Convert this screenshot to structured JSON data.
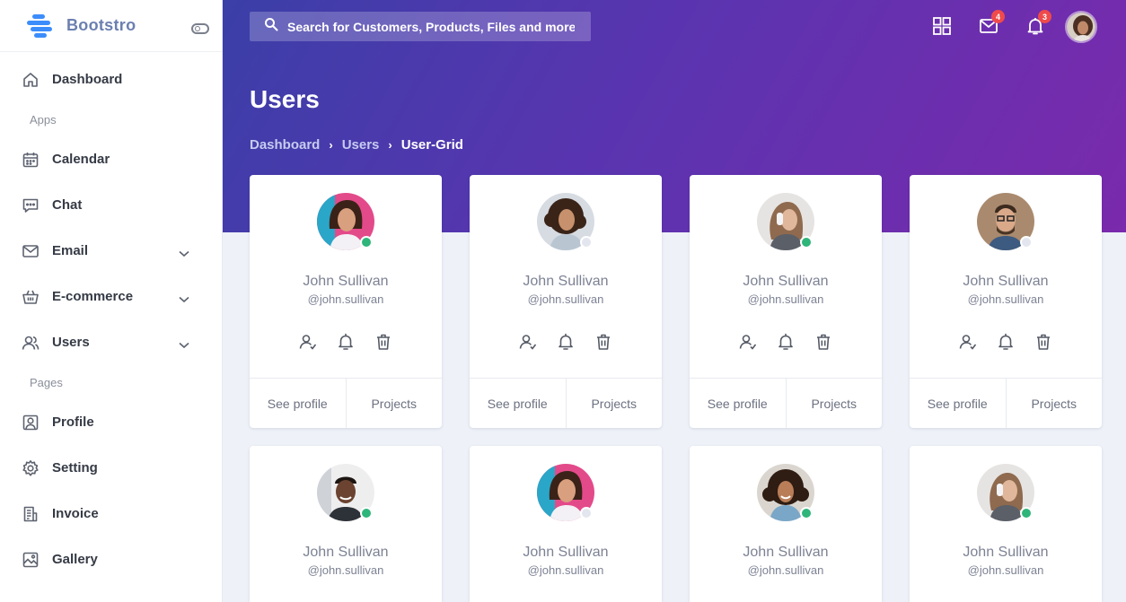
{
  "brand": {
    "name": "Bootstro",
    "accent": "#3c8dfb"
  },
  "sidebar": {
    "items": [
      {
        "label": "Dashboard",
        "icon": "home-icon"
      },
      {
        "section": "Apps"
      },
      {
        "label": "Calendar",
        "icon": "calendar-icon"
      },
      {
        "label": "Chat",
        "icon": "chat-icon"
      },
      {
        "label": "Email",
        "icon": "mail-icon",
        "expandable": true
      },
      {
        "label": "E-commerce",
        "icon": "basket-icon",
        "expandable": true
      },
      {
        "label": "Users",
        "icon": "users-icon",
        "expandable": true
      },
      {
        "section": "Pages"
      },
      {
        "label": "Profile",
        "icon": "profile-icon"
      },
      {
        "label": "Setting",
        "icon": "gear-icon"
      },
      {
        "label": "Invoice",
        "icon": "invoice-icon"
      },
      {
        "label": "Gallery",
        "icon": "gallery-icon"
      }
    ]
  },
  "header": {
    "search_placeholder": "Search for Customers, Products, Files and more.",
    "mail_count": "4",
    "notification_count": "3",
    "gradient": [
      "#3b3fa8",
      "#7a2aac"
    ]
  },
  "page": {
    "title": "Users",
    "breadcrumb": [
      "Dashboard",
      "Users",
      "User-Grid"
    ]
  },
  "users": [
    {
      "name": "John Sullivan",
      "handle": "@john.sullivan",
      "online": true,
      "see_profile": "See profile",
      "projects": "Projects"
    },
    {
      "name": "John Sullivan",
      "handle": "@john.sullivan",
      "online": false,
      "see_profile": "See profile",
      "projects": "Projects"
    },
    {
      "name": "John Sullivan",
      "handle": "@john.sullivan",
      "online": true,
      "see_profile": "See profile",
      "projects": "Projects"
    },
    {
      "name": "John Sullivan",
      "handle": "@john.sullivan",
      "online": false,
      "see_profile": "See profile",
      "projects": "Projects"
    },
    {
      "name": "John Sullivan",
      "handle": "@john.sullivan",
      "online": true
    },
    {
      "name": "John Sullivan",
      "handle": "@john.sullivan",
      "online": false
    },
    {
      "name": "John Sullivan",
      "handle": "@john.sullivan",
      "online": true
    },
    {
      "name": "John Sullivan",
      "handle": "@john.sullivan",
      "online": true
    }
  ],
  "colors": {
    "online": "#2fb57a",
    "offline": "#e3e6ee"
  }
}
